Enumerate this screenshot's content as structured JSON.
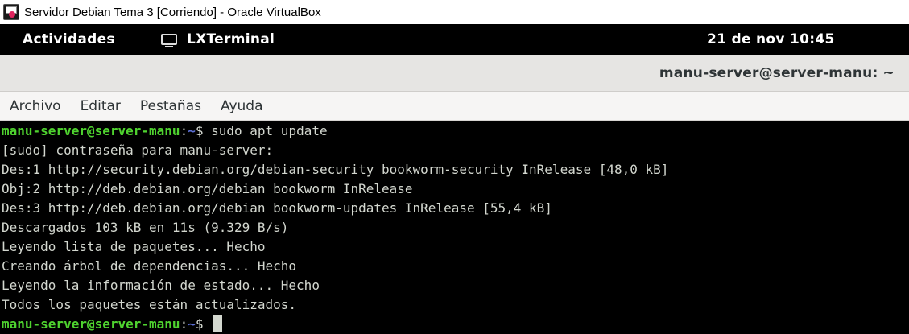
{
  "host_window": {
    "title": "Servidor Debian Tema 3 [Corriendo] - Oracle VirtualBox"
  },
  "topbar": {
    "activities": "Actividades",
    "app_name": "LXTerminal",
    "clock": "21 de nov  10:45"
  },
  "window": {
    "title": "manu-server@server-manu: ~"
  },
  "menu": {
    "items": [
      "Archivo",
      "Editar",
      "Pestañas",
      "Ayuda"
    ]
  },
  "terminal": {
    "prompt": {
      "user_host": "manu-server@server-manu",
      "sep": ":",
      "path": "~",
      "symbol": "$ "
    },
    "command": "sudo apt update",
    "output": [
      "[sudo] contraseña para manu-server:",
      "Des:1 http://security.debian.org/debian-security bookworm-security InRelease [48,0 kB]",
      "Obj:2 http://deb.debian.org/debian bookworm InRelease",
      "Des:3 http://deb.debian.org/debian bookworm-updates InRelease [55,4 kB]",
      "Descargados 103 kB en 11s (9.329 B/s)",
      "Leyendo lista de paquetes... Hecho",
      "Creando árbol de dependencias... Hecho",
      "Leyendo la información de estado... Hecho",
      "Todos los paquetes están actualizados."
    ]
  }
}
